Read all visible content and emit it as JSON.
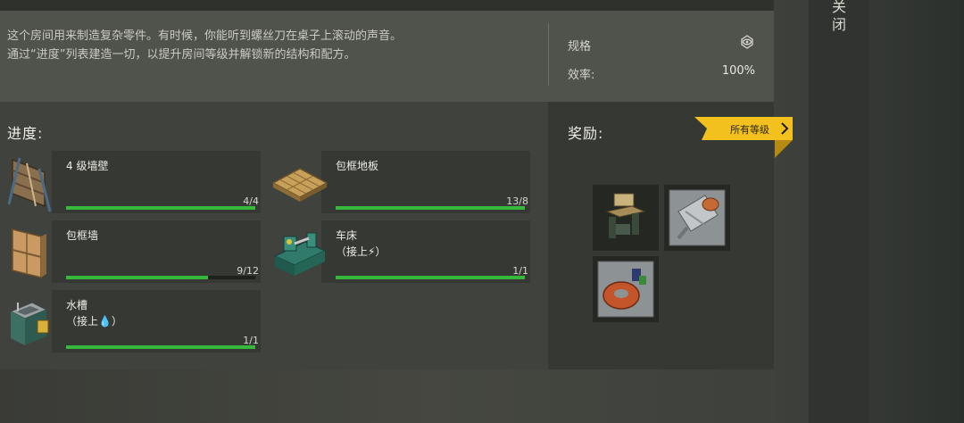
{
  "description": {
    "line1": "这个房间用来制造复杂零件。有时候，你能听到螺丝刀在桌子上滚动的声音。",
    "line2": "通过“进度”列表建造一切，以提升房间等级并解锁新的结构和配方。"
  },
  "specs": {
    "label": "规格",
    "efficiency_label": "效率:",
    "efficiency_value": "100%"
  },
  "progress": {
    "title": "进度:",
    "items": [
      {
        "name": "4 级墙壁",
        "sub": "",
        "count": "4/4",
        "fill": 1.0,
        "icon": "wall-icon"
      },
      {
        "name": "包框地板",
        "sub": "",
        "count": "13/8",
        "fill": 1.0,
        "icon": "floor-icon"
      },
      {
        "name": "包框墙",
        "sub": "",
        "count": "9/12",
        "fill": 0.75,
        "icon": "framed-wall-icon"
      },
      {
        "name": "车床",
        "sub": "（接上⚡）",
        "count": "1/1",
        "fill": 1.0,
        "icon": "lathe-icon"
      },
      {
        "name": "水槽",
        "sub": "（接上💧）",
        "count": "1/1",
        "fill": 1.0,
        "icon": "sink-icon"
      }
    ]
  },
  "rewards": {
    "title": "奖励:",
    "all_levels": "所有等级",
    "items": [
      "workbench-icon",
      "motor-icon",
      "copper-coil-icon"
    ]
  },
  "close": {
    "label": "关闭"
  },
  "colors": {
    "progress_fill": "#35b83c",
    "tag": "#f2c11d"
  }
}
